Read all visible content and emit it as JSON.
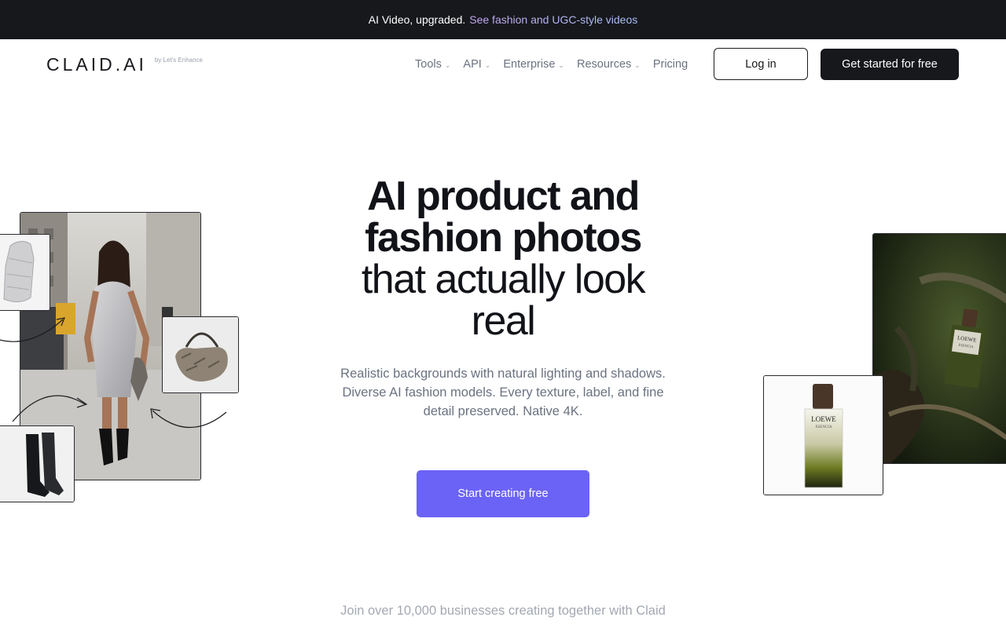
{
  "announcement": {
    "lead": "AI Video, upgraded.",
    "link": "See fashion and UGC-style videos"
  },
  "brand": {
    "logo": "CLAID.AI",
    "byline": "by Let's Enhance"
  },
  "nav": {
    "items": [
      {
        "label": "Tools",
        "has_dropdown": true
      },
      {
        "label": "API",
        "has_dropdown": true
      },
      {
        "label": "Enterprise",
        "has_dropdown": true
      },
      {
        "label": "Resources",
        "has_dropdown": true
      },
      {
        "label": "Pricing",
        "has_dropdown": false
      }
    ],
    "login": "Log in",
    "get_started": "Get started for free"
  },
  "hero": {
    "title_line1": "AI product and",
    "title_line2": "fashion photos",
    "title_line3": "that actually look",
    "title_line4": "real",
    "subtitle": "Realistic backgrounds with natural lighting and shadows. Diverse AI fashion models. Every texture, label, and fine detail preserved. Native 4K.",
    "cta": "Start creating free"
  },
  "social_proof": {
    "text": "Join over 10,000 businesses creating together with Claid"
  },
  "perfume_label": {
    "brand": "LOEWE",
    "line": "ESENCIA"
  },
  "colors": {
    "announcement_bg": "#17181c",
    "cta_bg": "#6b63f6",
    "primary_button_bg": "#17181c",
    "link_gradient_start": "#c4a8f3",
    "link_gradient_end": "#a9c3f7"
  }
}
